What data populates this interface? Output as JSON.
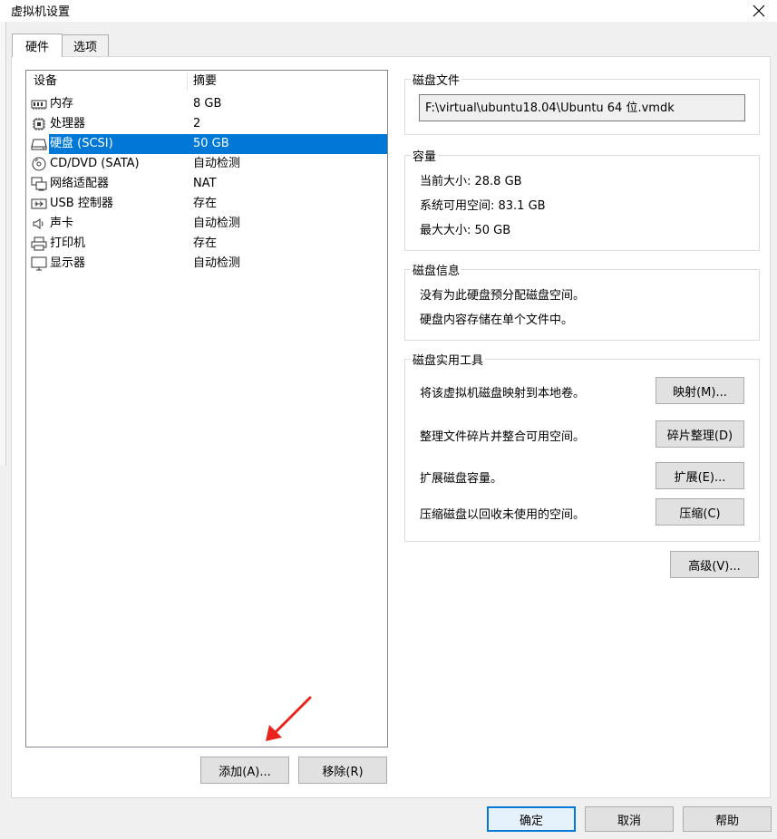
{
  "window": {
    "title": "虚拟机设置"
  },
  "tabs": [
    {
      "label": "硬件"
    },
    {
      "label": "选项"
    }
  ],
  "device_list": {
    "headers": {
      "device": "设备",
      "summary": "摘要"
    },
    "items": [
      {
        "name": "内存",
        "value": "8 GB",
        "icon": "memory-icon"
      },
      {
        "name": "处理器",
        "value": "2",
        "icon": "cpu-icon"
      },
      {
        "name": "硬盘 (SCSI)",
        "value": "50 GB",
        "icon": "harddisk-icon",
        "selected": true
      },
      {
        "name": "CD/DVD (SATA)",
        "value": "自动检测",
        "icon": "cd-dvd-icon"
      },
      {
        "name": "网络适配器",
        "value": "NAT",
        "icon": "network-adapter-icon"
      },
      {
        "name": "USB 控制器",
        "value": "存在",
        "icon": "usb-icon"
      },
      {
        "name": "声卡",
        "value": "自动检测",
        "icon": "speaker-icon"
      },
      {
        "name": "打印机",
        "value": "存在",
        "icon": "printer-icon"
      },
      {
        "name": "显示器",
        "value": "自动检测",
        "icon": "monitor-icon"
      }
    ]
  },
  "list_buttons": {
    "add": "添加(A)...",
    "remove": "移除(R)"
  },
  "disk_file": {
    "title": "磁盘文件",
    "path": "F:\\virtual\\ubuntu18.04\\Ubuntu 64 位.vmdk"
  },
  "capacity": {
    "title": "容量",
    "current_size": "当前大小: 28.8 GB",
    "free_space": "系统可用空间: 83.1 GB",
    "max_size": "最大大小: 50 GB"
  },
  "disk_info": {
    "title": "磁盘信息",
    "line1": "没有为此硬盘预分配磁盘空间。",
    "line2": "硬盘内容存储在单个文件中。"
  },
  "disk_utilities": {
    "title": "磁盘实用工具",
    "map": {
      "desc": "将该虚拟机磁盘映射到本地卷。",
      "button": "映射(M)..."
    },
    "defrag": {
      "desc": "整理文件碎片并整合可用空间。",
      "button": "碎片整理(D)"
    },
    "expand": {
      "desc": "扩展磁盘容量。",
      "button": "扩展(E)..."
    },
    "compact": {
      "desc": "压缩磁盘以回收未使用的空间。",
      "button": "压缩(C)"
    }
  },
  "advanced_button": "高级(V)...",
  "footer": {
    "ok": "确定",
    "cancel": "取消",
    "help": "帮助"
  },
  "colors": {
    "selection": "#0078d7",
    "arrow": "#e8241c"
  }
}
